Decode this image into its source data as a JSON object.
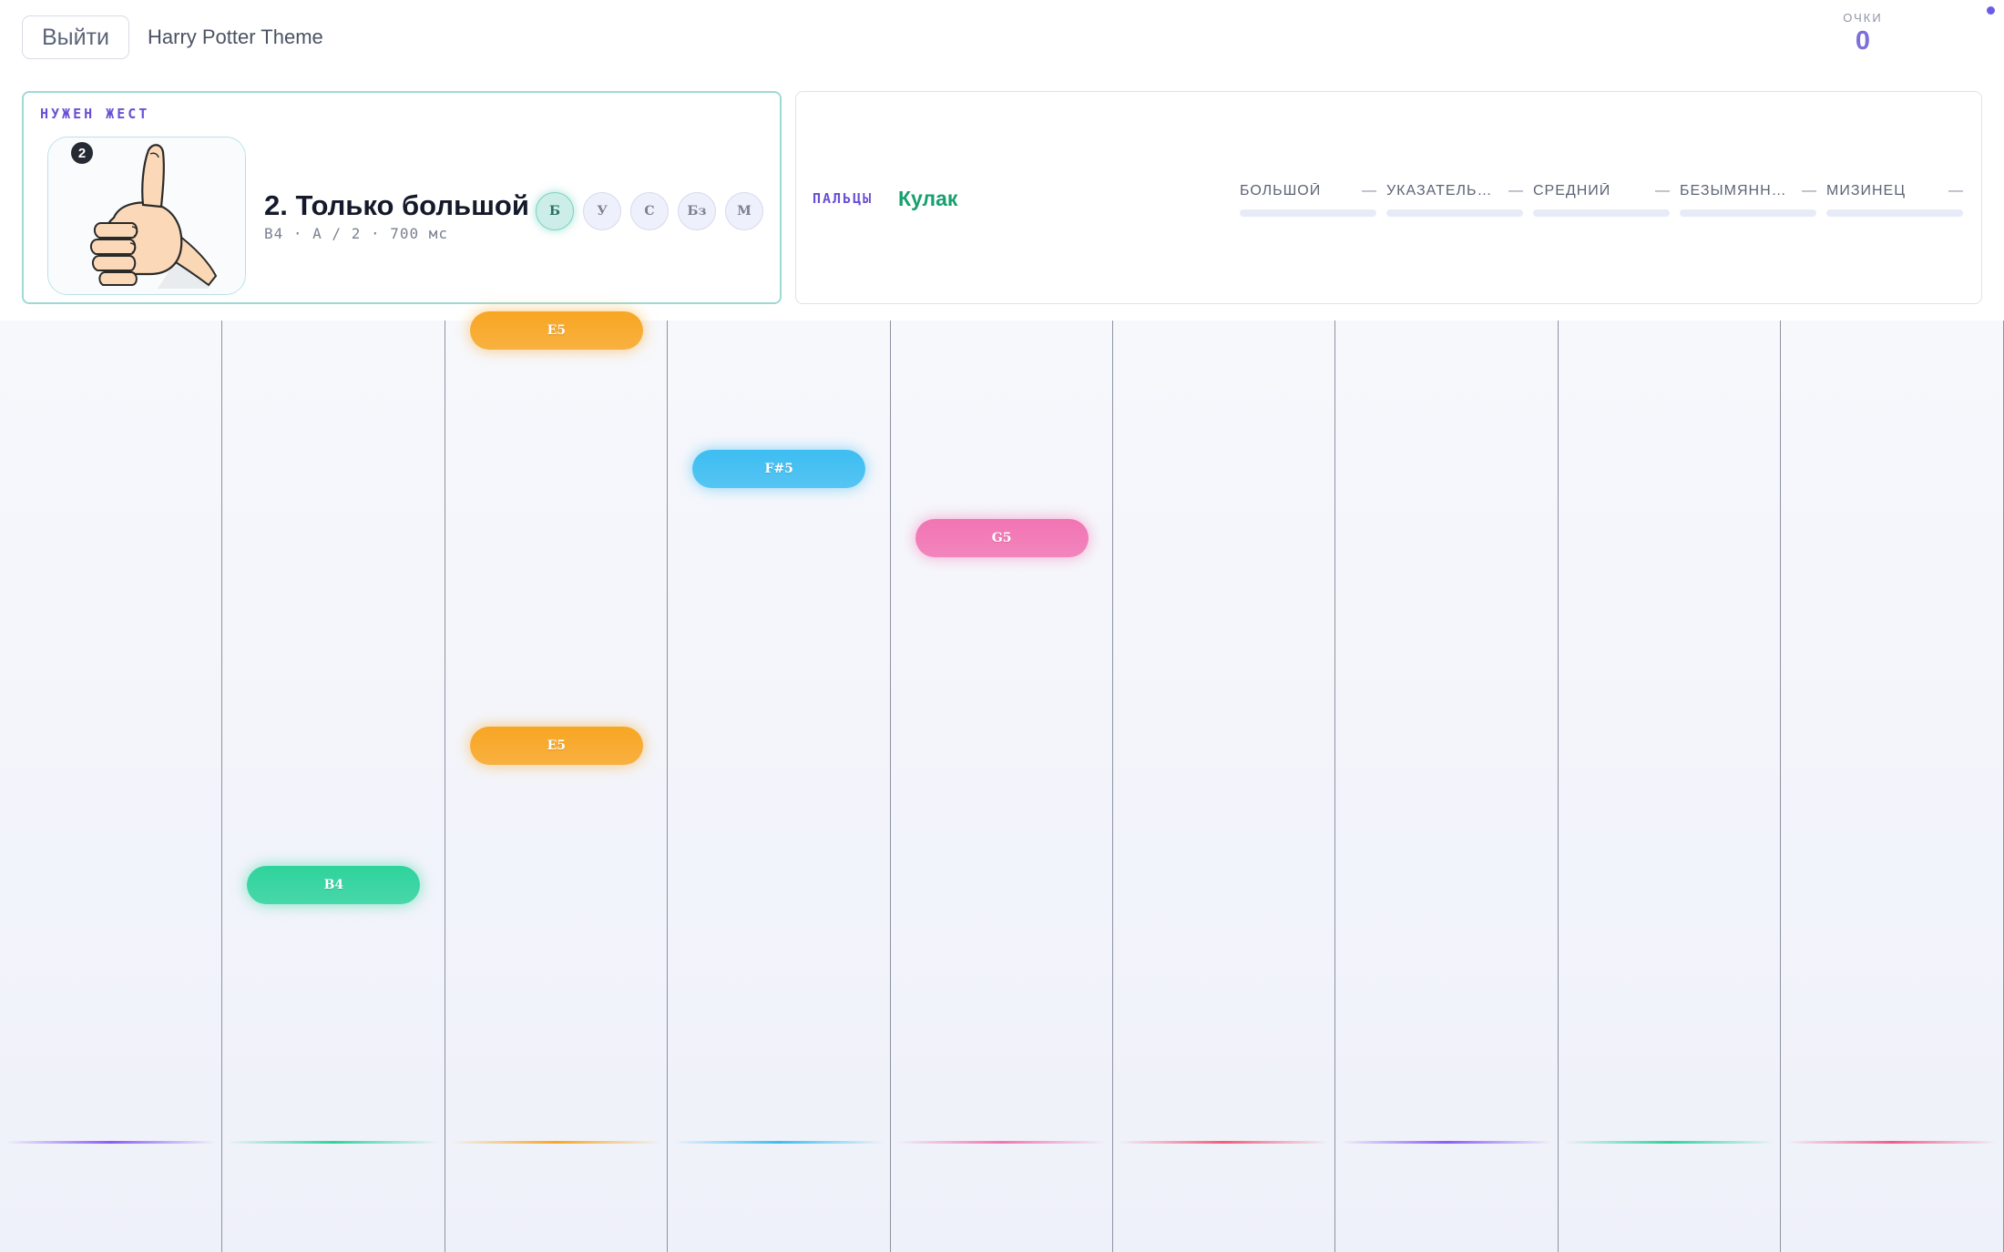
{
  "header": {
    "exit_label": "Выйти",
    "theme_title": "Harry Potter Theme",
    "score_label": "ОЧКИ",
    "score_value": "0"
  },
  "gesture_panel": {
    "caption": "НУЖЕН ЖЕСТ",
    "badge": "2",
    "image_icon": "thumbs-up-hand",
    "name": "2. Только большой",
    "meta": "B4 · A / 2 · 700 мс",
    "fingers": [
      {
        "label": "Б",
        "active": true
      },
      {
        "label": "У",
        "active": false
      },
      {
        "label": "С",
        "active": false
      },
      {
        "label": "Бз",
        "active": false
      },
      {
        "label": "М",
        "active": false
      }
    ]
  },
  "fingers_panel": {
    "caption": "ПАЛЬЦЫ",
    "state": "Кулак",
    "meters": [
      {
        "name": "БОЛЬШОЙ",
        "value": "—"
      },
      {
        "name": "УКАЗАТЕЛЬНЫЙ",
        "value": "—"
      },
      {
        "name": "СРЕДНИЙ",
        "value": "—"
      },
      {
        "name": "БЕЗЫМЯННЫЙ",
        "value": "—"
      },
      {
        "name": "МИЗИНЕЦ",
        "value": "—"
      }
    ]
  },
  "colors": {
    "green": "#2ed39c",
    "orange": "#f8a623",
    "blue": "#3dbdf2",
    "pink": "#f274b3",
    "purple": "#8b5cf6",
    "accent": "#6a4fd6"
  },
  "lanes": [
    {
      "hit_color": "#8b5cf6"
    },
    {
      "hit_color": "#2ed39c"
    },
    {
      "hit_color": "#f8a623"
    },
    {
      "hit_color": "#3dbdf2"
    },
    {
      "hit_color": "#f274b3"
    },
    {
      "hit_color": "#f25c7a"
    },
    {
      "hit_color": "#8b5cf6"
    },
    {
      "hit_color": "#2ed39c"
    },
    {
      "hit_color": "#f25c8a"
    }
  ],
  "notes": [
    {
      "label": "E5",
      "lane": 2,
      "color": "orange"
    },
    {
      "label": "F#5",
      "lane": 3,
      "color": "blue"
    },
    {
      "label": "G5",
      "lane": 4,
      "color": "pink"
    },
    {
      "label": "E5",
      "lane": 2,
      "color": "orange"
    },
    {
      "label": "B4",
      "lane": 1,
      "color": "green"
    }
  ]
}
